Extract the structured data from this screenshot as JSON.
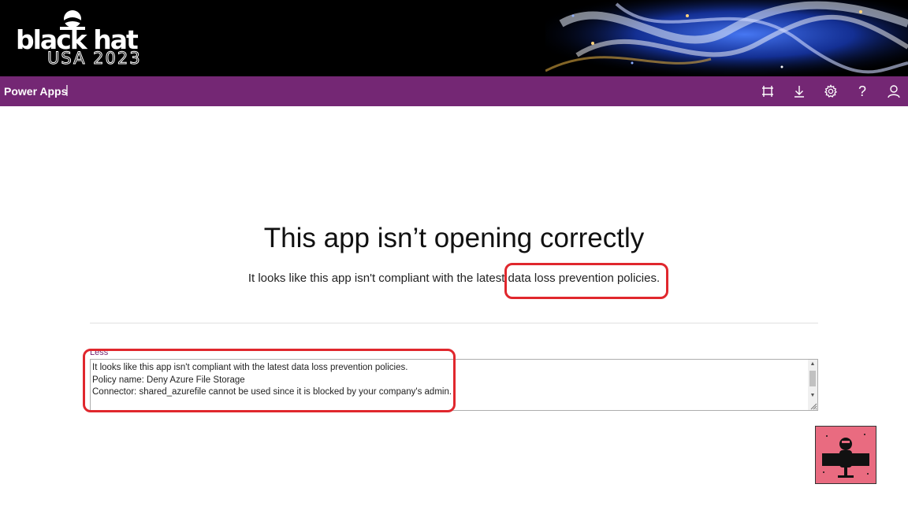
{
  "banner": {
    "logo_word": "black hat",
    "logo_sub": "USA 2023"
  },
  "app": {
    "title": "Power Apps",
    "separator": "|",
    "header_icons": [
      "fit-to-window-icon",
      "download-icon",
      "gear-icon",
      "help-icon",
      "user-icon"
    ],
    "help_glyph": "?"
  },
  "error": {
    "title": "This app isn’t opening correctly",
    "message": "It looks like this app isn't compliant with the latest data loss prevention policies.",
    "toggle_label": "Less",
    "details": "It looks like this app isn't compliant with the latest data loss prevention policies.\nPolicy name: Deny Azure File Storage\nConnector: shared_azurefile cannot be used since it is blocked by your company's admin."
  },
  "colors": {
    "banner": "#000000",
    "appbar": "#742774",
    "annotation": "#e0272d",
    "link": "#742774"
  }
}
